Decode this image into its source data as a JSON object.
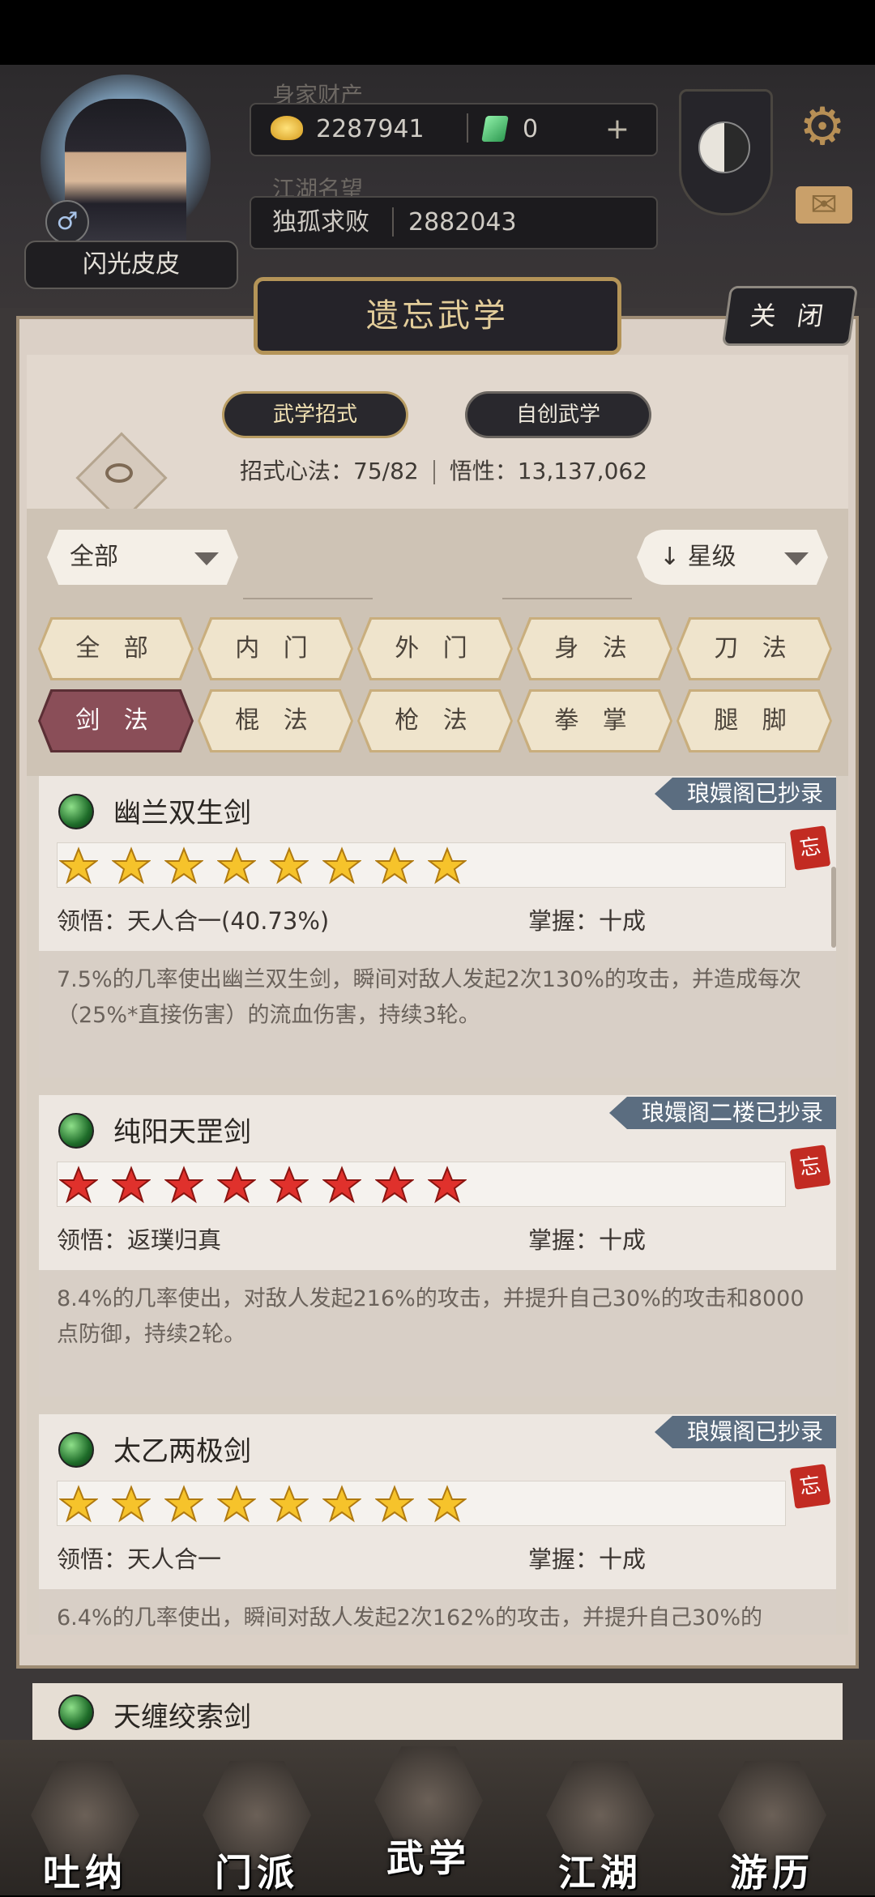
{
  "header": {
    "player_name": "闪光皮皮",
    "gender_symbol": "♂",
    "wealth_label": "身家财产",
    "gold": "2287941",
    "gems": "0",
    "plus": "+",
    "reputation_label": "江湖名望",
    "reputation_title": "独孤求败",
    "reputation_value": "2882043"
  },
  "dialog": {
    "title": "遗忘武学",
    "close_label": "关 闭",
    "tabs": {
      "moves": "武学招式",
      "custom": "自创武学"
    },
    "stats": {
      "moves_text": "招式心法：75/82",
      "insight_text": "悟性：13,137,062"
    },
    "filter": {
      "category": "全部",
      "sort": "星级",
      "sort_icon": "↓"
    },
    "categories": [
      "全 部",
      "内 门",
      "外 门",
      "身 法",
      "刀 法",
      "剑 法",
      "棍 法",
      "枪 法",
      "拳 掌",
      "腿 脚"
    ],
    "active_category_index": 5,
    "skills": [
      {
        "name": "幽兰双生剑",
        "ribbon": "琅嬛阁已抄录",
        "stars": 8,
        "star_color": "gold",
        "comprehension": "领悟：天人合一(40.73%)",
        "mastery": "掌握：十成",
        "description": "7.5%的几率使出幽兰双生剑，瞬间对敌人发起2次130%的攻击，并造成每次（25%*直接伤害）的流血伤害，持续3轮。",
        "forget_tag": "忘"
      },
      {
        "name": "纯阳天罡剑",
        "ribbon": "琅嬛阁二楼已抄录",
        "stars": 8,
        "star_color": "red",
        "comprehension": "领悟：返璞归真",
        "mastery": "掌握：十成",
        "description": "8.4%的几率使出，对敌人发起216%的攻击，并提升自己30%的攻击和8000点防御，持续2轮。",
        "forget_tag": "忘"
      },
      {
        "name": "太乙两极剑",
        "ribbon": "琅嬛阁已抄录",
        "stars": 8,
        "star_color": "gold",
        "comprehension": "领悟：天人合一",
        "mastery": "掌握：十成",
        "description": "6.4%的几率使出，瞬间对敌人发起2次162%的攻击，并提升自己30%的",
        "forget_tag": "忘"
      }
    ],
    "peek_skill": "天缠绞索剑"
  },
  "bottom_nav": [
    "吐纳",
    "门派",
    "武学",
    "江湖",
    "游历"
  ],
  "colors": {
    "accent_gold": "#e3cd9a",
    "active_tab": "#8a4e58",
    "ribbon": "#5b6d80",
    "gold_star": "#f6c32b",
    "red_star": "#e0312c"
  }
}
